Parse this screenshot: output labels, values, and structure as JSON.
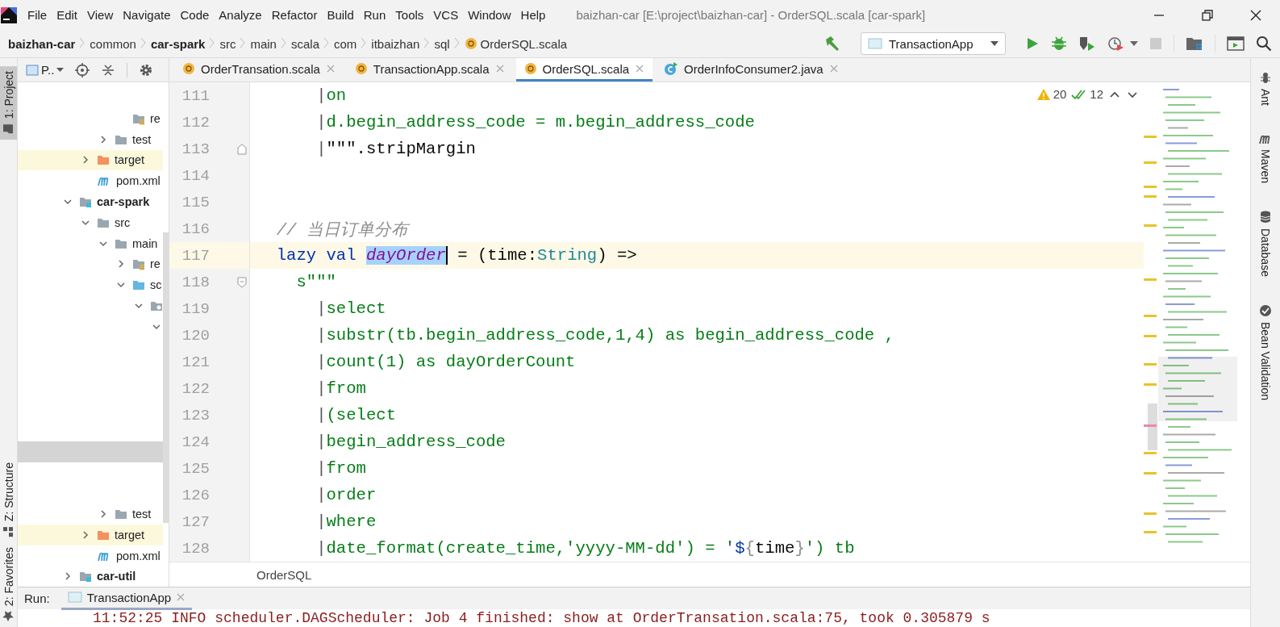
{
  "menu_bar": {
    "items": [
      "File",
      "Edit",
      "View",
      "Navigate",
      "Code",
      "Analyze",
      "Refactor",
      "Build",
      "Run",
      "Tools",
      "VCS",
      "Window",
      "Help"
    ],
    "title": "baizhan-car [E:\\project\\baizhan-car] - OrderSQL.scala [car-spark]"
  },
  "breadcrumbs": [
    {
      "label": "baizhan-car",
      "kind": "module"
    },
    {
      "label": "common",
      "kind": "folder"
    },
    {
      "label": "car-spark",
      "kind": "module"
    },
    {
      "label": "src",
      "kind": "folder"
    },
    {
      "label": "main",
      "kind": "folder"
    },
    {
      "label": "scala",
      "kind": "folder"
    },
    {
      "label": "com",
      "kind": "folder"
    },
    {
      "label": "itbaizhan",
      "kind": "folder"
    },
    {
      "label": "sql",
      "kind": "folder"
    },
    {
      "label": "OrderSQL.scala",
      "kind": "scala-file"
    }
  ],
  "run_configuration": "TransactionApp",
  "left_tool_tabs": [
    {
      "label": "1: Project",
      "kind": "project",
      "selected": true
    },
    {
      "label": "Z: Structure",
      "kind": "structure",
      "selected": false
    },
    {
      "label": "2: Favorites",
      "kind": "favorites",
      "selected": false
    }
  ],
  "right_tool_tabs": [
    {
      "label": "Ant",
      "kind": "ant"
    },
    {
      "label": "Maven",
      "kind": "maven"
    },
    {
      "label": "Database",
      "kind": "database"
    },
    {
      "label": "Bean Validation",
      "kind": "bean"
    }
  ],
  "project_view": {
    "title": "P..",
    "tree": [
      {
        "children": [
          {
            "children": [
              {
                "children": [
                  {
                    "label": "re",
                    "kind": "resources",
                    "selected": false
                  }
                ]
              },
              {
                "label": "test",
                "kind": "folder",
                "expanded": false,
                "selected": false
              }
            ]
          },
          {
            "label": "target",
            "kind": "excluded",
            "expanded": false,
            "selected": false
          },
          {
            "label": "pom.xml",
            "kind": "maven",
            "selected": false
          }
        ]
      },
      {
        "label": "car-spark",
        "kind": "module",
        "expanded": true,
        "selected": false,
        "children": [
          {
            "label": "src",
            "kind": "folder",
            "expanded": true,
            "selected": false,
            "children": [
              {
                "label": "main",
                "kind": "folder",
                "expanded": true,
                "selected": false,
                "children": [
                  {
                    "label": "re",
                    "kind": "resources",
                    "expanded": false,
                    "selected": false
                  },
                  {
                    "label": "sc",
                    "kind": "source-folder",
                    "expanded": true,
                    "selected": false,
                    "children": [
                      {
                        "kind": "package",
                        "expanded": true,
                        "selected": false,
                        "children": [
                          {
                            "expanded": true,
                            "selected": false,
                            "children": [
                              {
                                "selected": false
                              },
                              {
                                "selected": false
                              },
                              {
                                "selected": false
                              },
                              {
                                "selected": false
                              },
                              {
                                "selected": false
                              },
                              {
                                "selected": true
                              },
                              {
                                "selected": false
                              },
                              {
                                "selected": false
                              }
                            ]
                          }
                        ]
                      }
                    ]
                  }
                ]
              },
              {
                "label": "test",
                "kind": "folder",
                "expanded": false,
                "selected": false
              }
            ]
          },
          {
            "label": "target",
            "kind": "excluded",
            "expanded": false,
            "selected": false
          },
          {
            "label": "pom.xml",
            "kind": "maven",
            "selected": false
          }
        ]
      },
      {
        "label": "car-util",
        "kind": "module",
        "expanded": false,
        "selected": false
      }
    ]
  },
  "editor_tabs": [
    {
      "label": "OrderTransation.scala",
      "kind": "scala",
      "selected": false
    },
    {
      "label": "TransactionApp.scala",
      "kind": "scala",
      "selected": false
    },
    {
      "label": "OrderSQL.scala",
      "kind": "scala",
      "selected": true
    },
    {
      "label": "OrderInfoConsumer2.java",
      "kind": "java",
      "selected": false
    }
  ],
  "inspections": {
    "warnings": "20",
    "weak_warnings": "12"
  },
  "editor": {
    "lines": [
      {
        "number": "111",
        "current": false,
        "tokens": [
          {
            "text": "      |",
            "kind": "margin"
          },
          {
            "text": "on",
            "kind": "string"
          }
        ]
      },
      {
        "number": "112",
        "current": false,
        "tokens": [
          {
            "text": "      |",
            "kind": "margin"
          },
          {
            "text": "d.begin_address_code = m.begin_address_code",
            "kind": "string"
          }
        ]
      },
      {
        "number": "113",
        "current": false,
        "kind": "fold-end",
        "tokens": [
          {
            "text": "      |",
            "kind": "margin"
          },
          {
            "text": "\"\"\".stripMargin",
            "kind": "plain"
          }
        ]
      },
      {
        "number": "114",
        "current": false
      },
      {
        "number": "115",
        "current": false
      },
      {
        "number": "116",
        "current": false,
        "tokens": [
          {
            "text": "  // 当日订单分布",
            "kind": "comment"
          }
        ]
      },
      {
        "number": "117",
        "current": true,
        "tokens": [
          {
            "text": "  lazy val ",
            "kind": "keyword"
          },
          {
            "text": "dayOrder",
            "kind": "selection"
          },
          {
            "text": " = (time:",
            "kind": "plain"
          },
          {
            "text": "String",
            "kind": "type"
          },
          {
            "text": ") =>",
            "kind": "plain"
          }
        ]
      },
      {
        "number": "118",
        "current": false,
        "kind": "fold-start",
        "tokens": [
          {
            "text": "    s\"\"\"",
            "kind": "string"
          }
        ]
      },
      {
        "number": "119",
        "current": false,
        "tokens": [
          {
            "text": "      |",
            "kind": "margin"
          },
          {
            "text": "select",
            "kind": "string"
          }
        ]
      },
      {
        "number": "120",
        "current": false,
        "tokens": [
          {
            "text": "      |",
            "kind": "margin"
          },
          {
            "text": "substr(tb.begin_address_code,1,4) as begin_address_code ,",
            "kind": "string"
          }
        ]
      },
      {
        "number": "121",
        "current": false,
        "tokens": [
          {
            "text": "      |",
            "kind": "margin"
          },
          {
            "text": "count(1) as dayOrderCount",
            "kind": "string"
          }
        ]
      },
      {
        "number": "122",
        "current": false,
        "tokens": [
          {
            "text": "      |",
            "kind": "margin"
          },
          {
            "text": "from",
            "kind": "string"
          }
        ]
      },
      {
        "number": "123",
        "current": false,
        "tokens": [
          {
            "text": "      |",
            "kind": "margin"
          },
          {
            "text": "(select",
            "kind": "string"
          }
        ]
      },
      {
        "number": "124",
        "current": false,
        "tokens": [
          {
            "text": "      |",
            "kind": "margin"
          },
          {
            "text": "begin_address_code",
            "kind": "string"
          }
        ]
      },
      {
        "number": "125",
        "current": false,
        "tokens": [
          {
            "text": "      |",
            "kind": "margin"
          },
          {
            "text": "from",
            "kind": "string"
          }
        ]
      },
      {
        "number": "126",
        "current": false,
        "tokens": [
          {
            "text": "      |",
            "kind": "margin"
          },
          {
            "text": "order",
            "kind": "string"
          }
        ]
      },
      {
        "number": "127",
        "current": false,
        "tokens": [
          {
            "text": "      |",
            "kind": "margin"
          },
          {
            "text": "where",
            "kind": "string"
          }
        ]
      },
      {
        "number": "128",
        "current": false,
        "tokens": [
          {
            "text": "      |",
            "kind": "margin"
          },
          {
            "text": "date_format(create_time,'yyyy-MM-dd') = '",
            "kind": "string"
          },
          {
            "text": "$",
            "kind": "interp"
          },
          {
            "text": "{",
            "kind": "brace"
          },
          {
            "text": "time",
            "kind": "plain"
          },
          {
            "text": "}",
            "kind": "brace"
          },
          {
            "text": "') tb",
            "kind": "string"
          }
        ]
      }
    ],
    "breadcrumb": "OrderSQL"
  },
  "run_panel": {
    "label": "Run:",
    "tab": "TransactionApp",
    "console": "11:52:25 INFO scheduler.DAGScheduler: Job 4 finished: show at OrderTransation.scala:75, took 0.305879 s"
  }
}
